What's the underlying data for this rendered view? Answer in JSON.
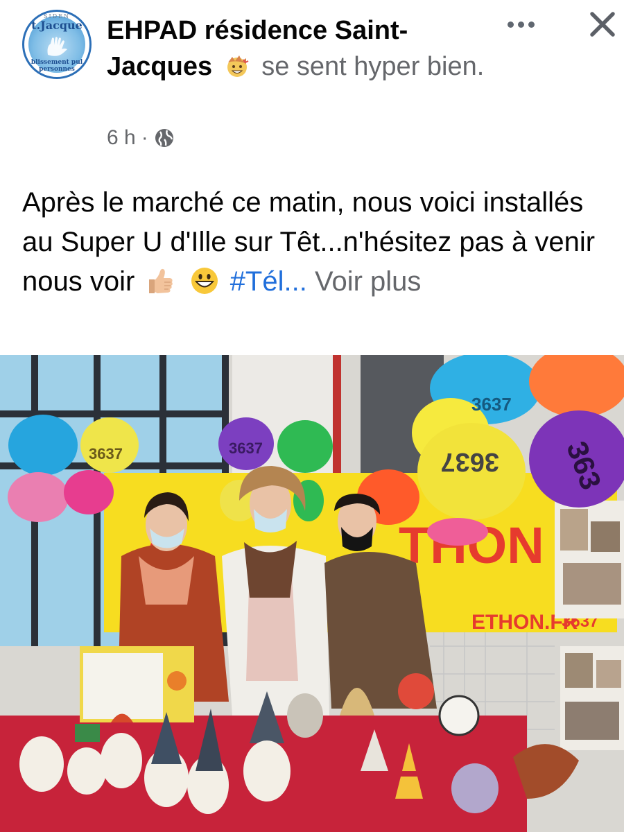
{
  "post": {
    "author": "EHPAD résidence Saint-Jacques",
    "feeling": "se sent hyper bien.",
    "time": "6 h",
    "separator": "·",
    "privacy_icon": "globe-icon",
    "text_main": "Après le marché ce matin, nous voici installés au Super U d'Ille sur Têt...n'hésitez pas à venir nous voir",
    "hashtag": "#Tél...",
    "see_more": "Voir plus"
  },
  "avatar": {
    "top_small": "SIDEN",
    "top_text": "t.Jacque",
    "bottom_line1": "blissement pul",
    "bottom_line2": "personnes"
  },
  "photo": {
    "balloon_texts": [
      "3637",
      "3637",
      "3637",
      "3637",
      "363"
    ],
    "banner_text": "THON",
    "banner_text2": "ETHON.FR",
    "banner_number": "3637"
  },
  "colors": {
    "link": "#216fdb",
    "secondary_text": "#65676b",
    "primary_text": "#050505"
  }
}
